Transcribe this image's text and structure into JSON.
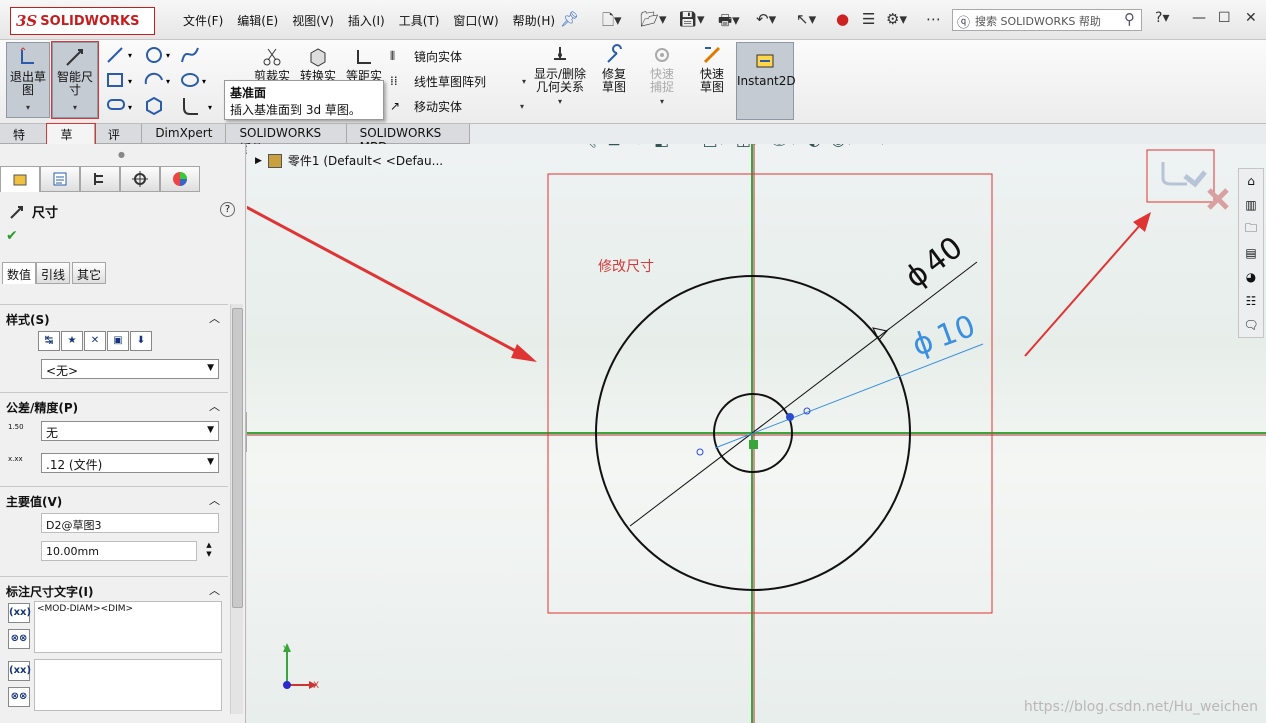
{
  "app": {
    "logo_mark": "3S",
    "logo_name": "SOLIDWORKS",
    "menus": [
      "文件(F)",
      "编辑(E)",
      "视图(V)",
      "插入(I)",
      "工具(T)",
      "窗口(W)",
      "帮助(H)"
    ],
    "search_placeholder": "搜索 SOLIDWORKS 帮助",
    "help_glyph": "?"
  },
  "ribbon": {
    "exit_sketch": "退出草图",
    "smart_dimension": "智能尺寸",
    "trim": "剪裁实",
    "convert": "转换实",
    "offset": "等距实",
    "mirror": "镜向实体",
    "linear_pattern": "线性草图阵列",
    "move": "移动实体",
    "show_delete_relations": "显示/删除几何关系",
    "repair_sketch": "修复草图",
    "quick_snaps": "快速捕捉",
    "rapid_sketch": "快速草图",
    "instant2d": "Instant2D"
  },
  "tooltip": {
    "title": "基准面",
    "body": "插入基准面到 3d 草图。"
  },
  "tabs": [
    "特征",
    "草图",
    "评估",
    "DimXpert",
    "SOLIDWORKS 插件",
    "SOLIDWORKS MBD"
  ],
  "panel": {
    "title": "尺寸",
    "help": "?",
    "ok": "✔",
    "subtabs": [
      "数值",
      "引线",
      "其它"
    ],
    "style_header": "样式(S)",
    "style_value": "<无>",
    "tolerance_header": "公差/精度(P)",
    "tolerance_value": "无",
    "precision_value": ".12 (文件)",
    "tol_icon_text": "1.50",
    "prec_icon_text": "x.xx",
    "primary_header": "主要值(V)",
    "primary_name": "D2@草图3",
    "primary_value": "10.00mm",
    "dim_text_header": "标注尺寸文字(I)",
    "dim_text_value": "<MOD-DIAM><DIM>",
    "dim_text_value2": ""
  },
  "graphics": {
    "tree_label": "零件1  (Default< <Defau...",
    "annotation": "修改尺寸",
    "dim_outer": "40",
    "dim_inner": "10",
    "diam_symbol": "ϕ",
    "axis_x": "X",
    "axis_y": "Y",
    "watermark": "https://blog.csdn.net/Hu_weichen"
  },
  "colors": {
    "accent_red": "#c41e1e",
    "highlight_red": "#e03434",
    "dim_blue": "#3a8fe0",
    "axis_green": "#3aa53a",
    "axis_red": "#b03030"
  }
}
